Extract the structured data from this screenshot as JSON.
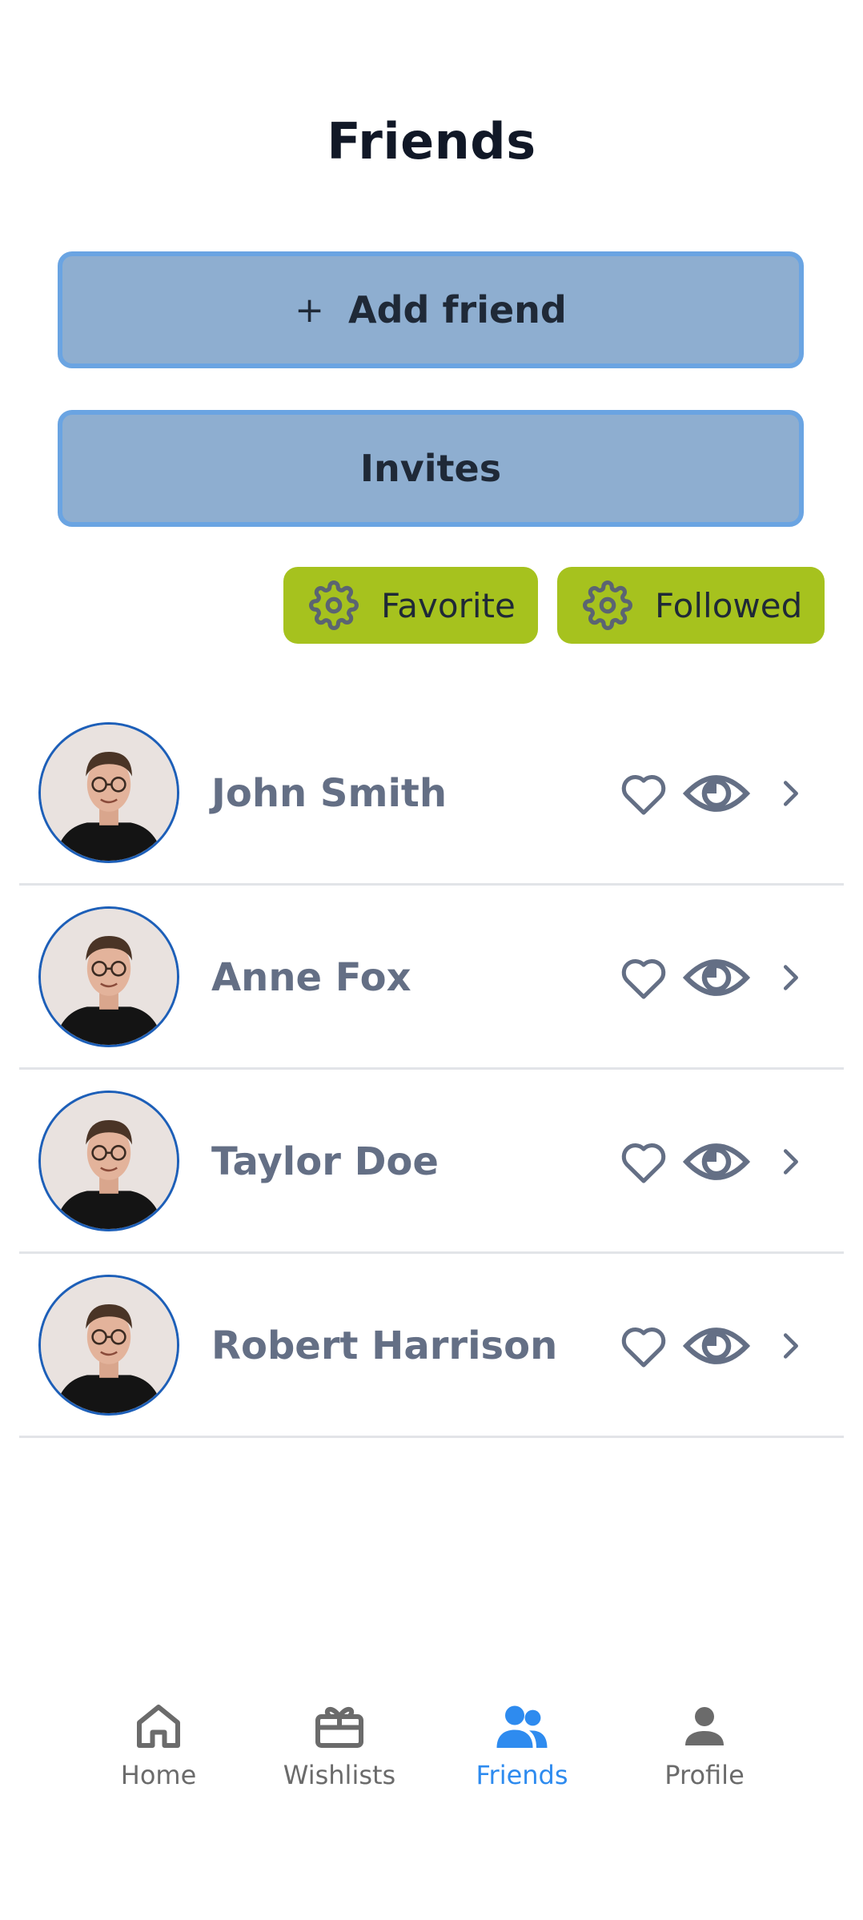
{
  "header": {
    "title": "Friends"
  },
  "actions": {
    "add_friend_icon": "+",
    "add_friend_label": "Add friend",
    "invites_label": "Invites"
  },
  "filters": {
    "favorite_label": "Favorite",
    "followed_label": "Followed",
    "icon": "gear-icon",
    "chip_color": "#a6c21e"
  },
  "friends": [
    {
      "name": "John Smith"
    },
    {
      "name": "Anne Fox"
    },
    {
      "name": "Taylor Doe"
    },
    {
      "name": "Robert Harrison"
    }
  ],
  "nav": {
    "items": [
      {
        "label": "Home",
        "icon": "home-icon"
      },
      {
        "label": "Wishlists",
        "icon": "gift-icon"
      },
      {
        "label": "Friends",
        "icon": "friends-icon",
        "active": true
      },
      {
        "label": "Profile",
        "icon": "person-icon"
      }
    ]
  },
  "colors": {
    "accent": "#2e8bef",
    "button_bg": "#8eaed0",
    "button_border": "#6aa4e2",
    "name_text": "#646f85",
    "icon_gray": "#646f85"
  }
}
